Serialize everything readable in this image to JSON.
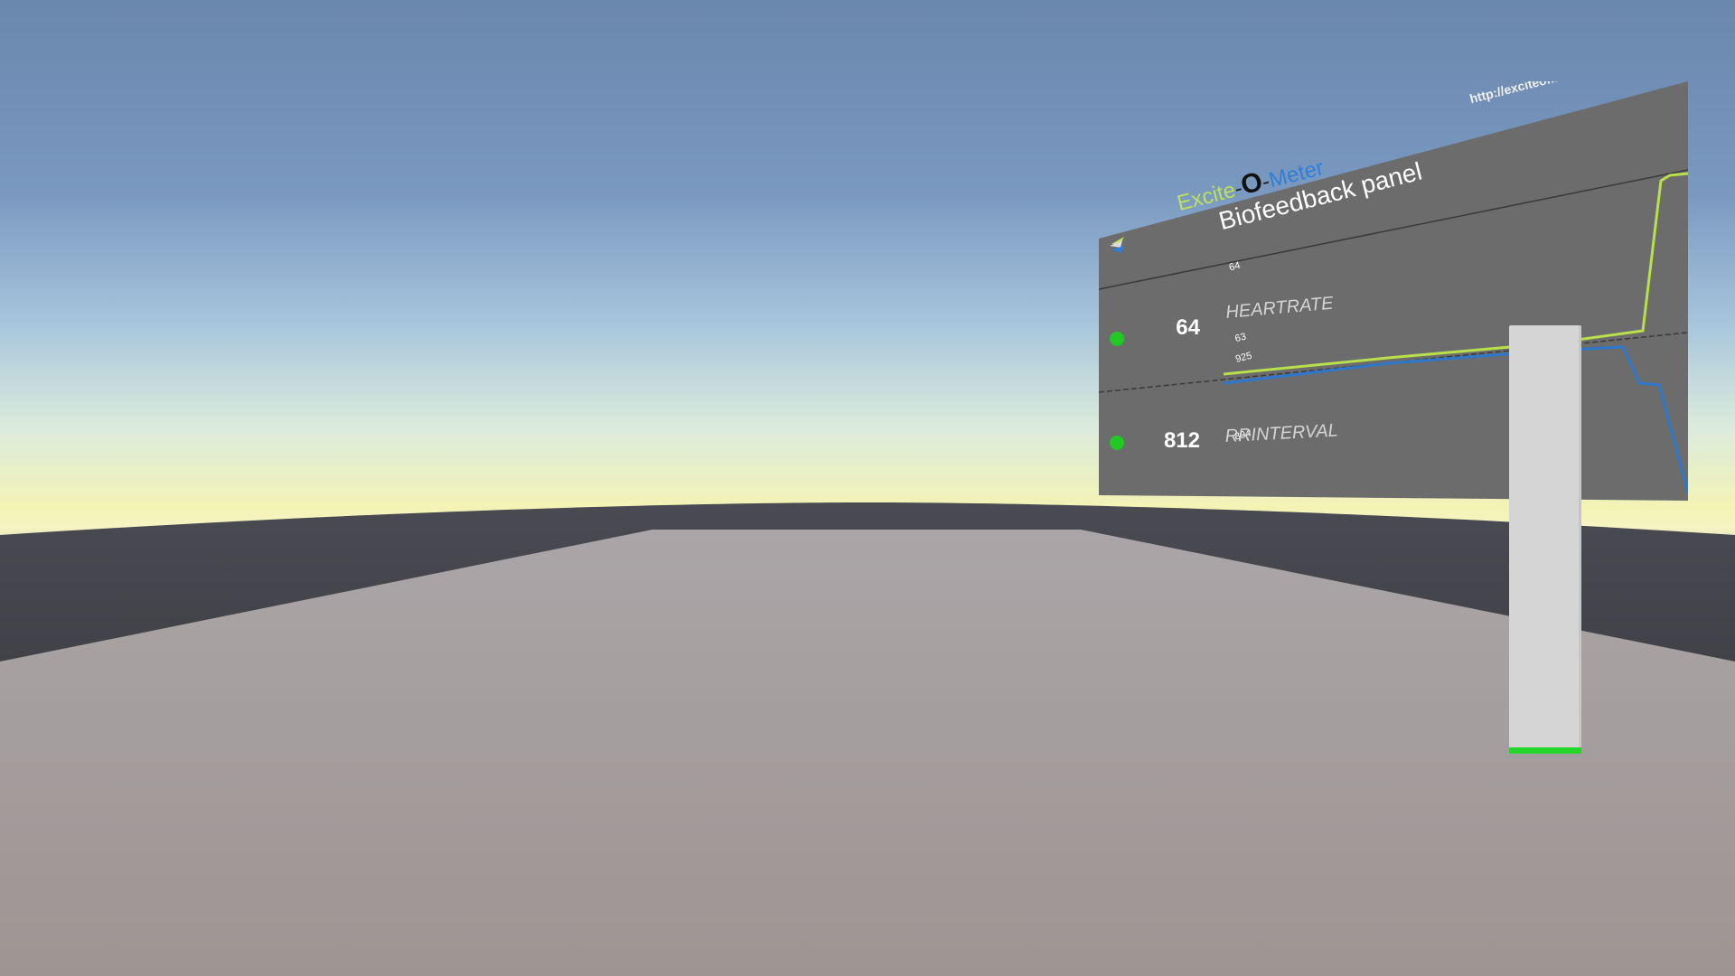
{
  "panel": {
    "brand_excite": "Excite",
    "brand_dash1": "-",
    "brand_o": "O",
    "brand_dash2": "-",
    "brand_meter": "Meter",
    "title": "Biofeedback panel",
    "url": "http://exciteometer.eu",
    "logo_icon": "excite-o-meter-logo-icon",
    "colors": {
      "background": "#6c6c6c",
      "brand_green": "#bfe05a",
      "brand_blue": "#2f7fd8",
      "status_green": "#22c922",
      "heartrate_line": "#b9e04b",
      "rrinterval_line": "#2e78cc"
    },
    "metrics": [
      {
        "label": "HEARTRATE",
        "value": "64",
        "max_label": "64",
        "min_label": "63",
        "status": "connected"
      },
      {
        "label": "RRINTERVAL",
        "value": "812",
        "max_label": "925",
        "min_label": "894",
        "status": "connected"
      }
    ]
  },
  "indicator_bar": {
    "fill_fraction": 0.015,
    "fill_color": "#25d62b"
  }
}
